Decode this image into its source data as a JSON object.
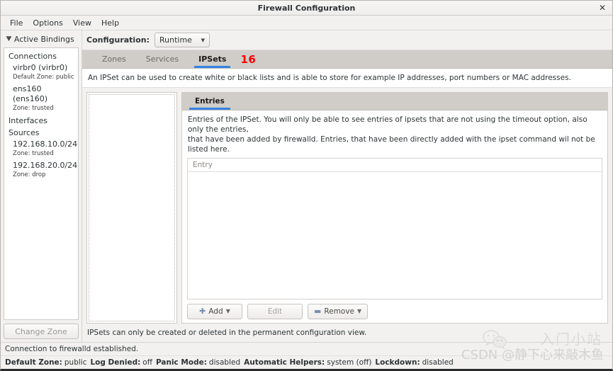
{
  "window": {
    "title": "Firewall Configuration",
    "close_label": "✕"
  },
  "menubar": {
    "items": [
      {
        "label": "File"
      },
      {
        "label": "Options"
      },
      {
        "label": "View"
      },
      {
        "label": "Help"
      }
    ]
  },
  "sidebar": {
    "expander_label": "Active Bindings",
    "expander_icon": "chevron-down-icon",
    "groups": [
      {
        "label": "Connections",
        "items": [
          {
            "name": "virbr0 (virbr0)",
            "sub": "Default Zone: public"
          },
          {
            "name": "ens160 (ens160)",
            "sub": "Zone: trusted"
          }
        ]
      },
      {
        "label": "Interfaces",
        "items": []
      },
      {
        "label": "Sources",
        "items": [
          {
            "name": "192.168.10.0/24",
            "sub": "Zone: trusted"
          },
          {
            "name": "192.168.20.0/24",
            "sub": "Zone: drop"
          }
        ]
      }
    ],
    "change_zone_label": "Change Zone"
  },
  "toolbar": {
    "configuration_label": "Configuration:",
    "configuration_value": "Runtime",
    "dropdown_icon": "chevron-down-icon"
  },
  "tabs": {
    "items": [
      {
        "label": "Zones",
        "active": false
      },
      {
        "label": "Services",
        "active": false
      },
      {
        "label": "IPSets",
        "active": true
      }
    ],
    "annotation": "16",
    "annotation_color": "#fd0000",
    "active_underline_color": "#3584e4"
  },
  "description": "An IPSet can be used to create white or black lists and is able to store for example IP addresses, port numbers or MAC addresses.",
  "detail": {
    "subtabs": [
      {
        "label": "Entries",
        "active": true
      }
    ],
    "desc_line1": "Entries of the IPSet. You will only be able to see entries of ipsets that are not using the timeout option, also only the entries,",
    "desc_line2": "that have been added by firewalld. Entries, that have been directly added with the ipset command wil not be listed here.",
    "table": {
      "columns": [
        "Entry"
      ],
      "rows": []
    },
    "buttons": [
      {
        "label": "Add",
        "icon": "plus-icon",
        "icon_glyph": "✚",
        "dropdown": true,
        "disabled": false
      },
      {
        "label": "Edit",
        "icon": "",
        "icon_glyph": "",
        "dropdown": false,
        "disabled": true
      },
      {
        "label": "Remove",
        "icon": "minus-icon",
        "icon_glyph": "➖",
        "dropdown": true,
        "disabled": false
      }
    ],
    "note": "IPSets can only be created or deleted in the permanent configuration view."
  },
  "status": {
    "connection": "Connection to firewalld established.",
    "fields": [
      {
        "label": "Default Zone:",
        "value": "public"
      },
      {
        "label": "Log Denied:",
        "value": "off"
      },
      {
        "label": "Panic Mode:",
        "value": "disabled"
      },
      {
        "label": "Automatic Helpers:",
        "value": "system (off)"
      },
      {
        "label": "Lockdown:",
        "value": "disabled"
      }
    ]
  },
  "watermark": {
    "chinese": "入门小站",
    "csdn": "CSDN @静下心来敲木鱼",
    "logo": "wechat-icon"
  }
}
